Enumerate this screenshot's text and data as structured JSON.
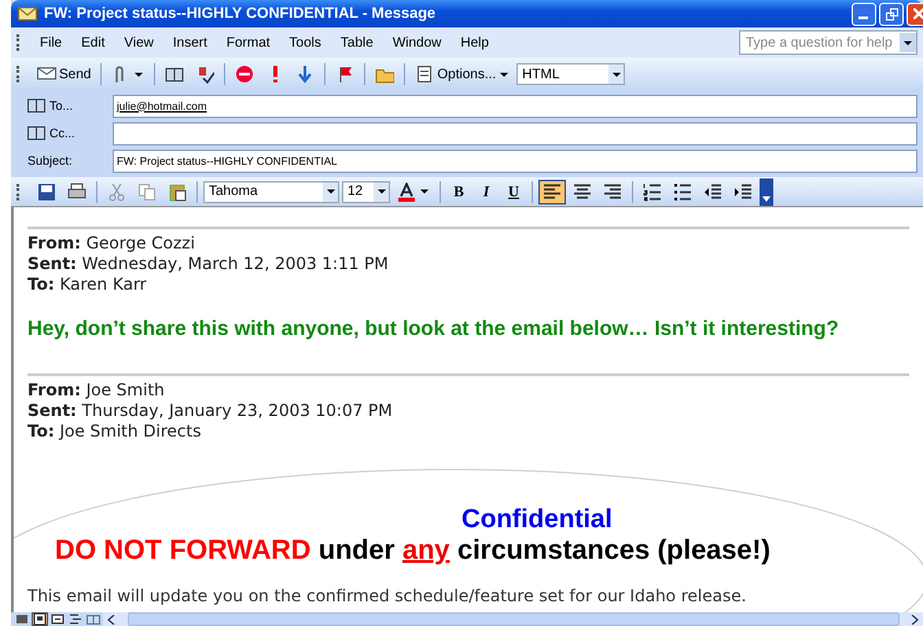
{
  "window": {
    "title": "FW: Project status--HIGHLY CONFIDENTIAL - Message"
  },
  "menu": [
    "File",
    "Edit",
    "View",
    "Insert",
    "Format",
    "Tools",
    "Table",
    "Window",
    "Help"
  ],
  "help_search": {
    "placeholder": "Type a question for help"
  },
  "toolbar": [
    {
      "kind": "send",
      "label": "Send"
    },
    {
      "kind": "attach"
    },
    {
      "kind": "book"
    },
    {
      "kind": "check"
    },
    {
      "kind": "stop"
    },
    {
      "kind": "high"
    },
    {
      "kind": "low"
    },
    {
      "kind": "flag"
    },
    {
      "kind": "folder"
    },
    {
      "kind": "options",
      "label": "Options..."
    }
  ],
  "format_select": {
    "value": "HTML"
  },
  "fields": [
    {
      "label": "To...",
      "value": "julie@hotmail.com",
      "kind": "address"
    },
    {
      "label": "Cc...",
      "kind": "address"
    },
    {
      "label": "Subject:",
      "value": "FW: Project status--HIGHLY CONFIDENTIAL",
      "kind": "text"
    }
  ],
  "format_bar": {
    "font": "Tahoma",
    "size": "12",
    "bold": "B",
    "italic": "I",
    "underline": "U",
    "align": [
      {
        "kind": "left",
        "selected": true
      },
      {
        "kind": "center",
        "selected": false
      },
      {
        "kind": "right",
        "selected": false
      }
    ]
  },
  "body": {
    "headers": [
      [
        "**From:** George Cozzi",
        "**Sent:** Wednesday, March 12, 2003 1:11 PM",
        "**To:** Karen Karr"
      ],
      [
        "**From:** Joe Smith",
        "**Sent:** Thursday, January 23, 2003 10:07 PM",
        "**To:** Joe Smith Directs"
      ]
    ],
    "note": "Hey, don’t share this with anyone, but look at the email below… Isn’t it interesting?",
    "banner_title": "Confidential",
    "banner_line": [
      {
        "text": "DO NOT FORWARD",
        "kind": "alert"
      },
      {
        "text": " under ",
        "kind": "plain"
      },
      {
        "text": "any",
        "kind": "emphasis"
      },
      {
        "text": " circumstances (please!)",
        "kind": "plain"
      }
    ],
    "paragraph": "This email will update you on the confirmed schedule/feature set for our Idaho release."
  },
  "views": [
    {
      "kind": "normal",
      "selected": false
    },
    {
      "kind": "web",
      "selected": true
    },
    {
      "kind": "print",
      "selected": false
    },
    {
      "kind": "outline",
      "selected": false
    },
    {
      "kind": "reading",
      "selected": false
    }
  ]
}
